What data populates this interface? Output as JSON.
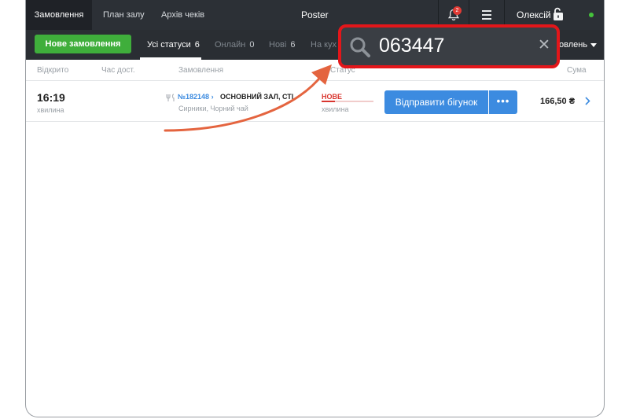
{
  "topbar": {
    "tabs": [
      {
        "label": "Замовлення",
        "active": true
      },
      {
        "label": "План залу",
        "active": false
      },
      {
        "label": "Архів чеків",
        "active": false
      }
    ],
    "title": "Poster",
    "notification_count": "2",
    "user_name": "Олексій",
    "online": true,
    "icons": [
      "bell-icon",
      "menu-icon",
      "unlock-icon"
    ]
  },
  "filters": {
    "new_order_label": "Нове замовлення",
    "tabs": [
      {
        "label": "Усі статуси",
        "count": "6",
        "active": true
      },
      {
        "label": "Онлайн",
        "count": "0",
        "active": false
      },
      {
        "label": "Нові",
        "count": "6",
        "active": false
      },
      {
        "label": "На кух",
        "count": "",
        "active": false
      }
    ],
    "sort_label": "овлень"
  },
  "table": {
    "columns": [
      "Відкрито",
      "Час дост.",
      "Замовлення",
      "Статус",
      "Сума"
    ],
    "rows": [
      {
        "time": "16:19",
        "time_sub": "хвилина",
        "order_number": "№182148 ›",
        "hall": "ОСНОВНИЙ ЗАЛ, СТІ",
        "items": "Сирники, Чорний чай",
        "status": "НОВЕ",
        "status_sub": "хвилина",
        "status_progress": 0.25,
        "action_label": "Відправити бігунок",
        "more_label": "•••",
        "sum": "166,50 ₴"
      }
    ]
  },
  "search": {
    "value": "063447",
    "clear_icon": "✕"
  },
  "colors": {
    "accent_green": "#3fae3b",
    "accent_blue": "#3c8be0",
    "status_red": "#d9362f",
    "highlight_red": "#e3161a",
    "annotation_arrow": "#e4643f",
    "dark_bar": "#2c3036"
  }
}
